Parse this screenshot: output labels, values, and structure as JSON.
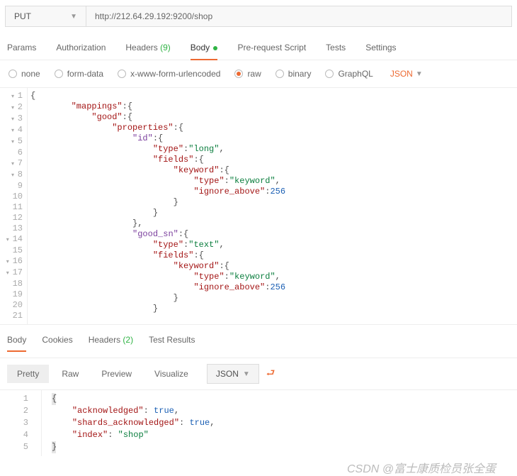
{
  "url_bar": {
    "method": "PUT",
    "url": "http://212.64.29.192:9200/shop"
  },
  "tabs": {
    "params": "Params",
    "auth": "Authorization",
    "headers_label": "Headers",
    "headers_count": "(9)",
    "body": "Body",
    "prerequest": "Pre-request Script",
    "tests": "Tests",
    "settings": "Settings"
  },
  "body_types": {
    "none": "none",
    "formdata": "form-data",
    "xwww": "x-www-form-urlencoded",
    "raw": "raw",
    "binary": "binary",
    "graphql": "GraphQL",
    "format": "JSON"
  },
  "req_lines": [
    {
      "n": 1,
      "f": 1,
      "i": 0,
      "t": "{",
      "c": ""
    },
    {
      "n": 2,
      "f": 1,
      "i": 2,
      "t": "\"mappings\":{",
      "c": "k"
    },
    {
      "n": 3,
      "f": 1,
      "i": 3,
      "t": "\"good\":{",
      "c": "k"
    },
    {
      "n": 4,
      "f": 1,
      "i": 4,
      "t": "\"properties\":{",
      "c": "k"
    },
    {
      "n": 5,
      "f": 1,
      "i": 5,
      "t": "\"id\":{",
      "c": "id"
    },
    {
      "n": 6,
      "f": 0,
      "i": 6,
      "t": "\"type\":\"long\",",
      "c": "kv"
    },
    {
      "n": 7,
      "f": 1,
      "i": 6,
      "t": "\"fields\":{",
      "c": "k"
    },
    {
      "n": 8,
      "f": 1,
      "i": 7,
      "t": "\"keyword\":{",
      "c": "k"
    },
    {
      "n": 9,
      "f": 0,
      "i": 8,
      "t": "\"type\":\"keyword\",",
      "c": "kv"
    },
    {
      "n": 10,
      "f": 0,
      "i": 8,
      "t": "\"ignore_above\":256",
      "c": "kn"
    },
    {
      "n": 11,
      "f": 0,
      "i": 7,
      "t": "}",
      "c": ""
    },
    {
      "n": 12,
      "f": 0,
      "i": 6,
      "t": "}",
      "c": ""
    },
    {
      "n": 13,
      "f": 0,
      "i": 5,
      "t": "},",
      "c": ""
    },
    {
      "n": 14,
      "f": 1,
      "i": 5,
      "t": "\"good_sn\":{",
      "c": "id"
    },
    {
      "n": 15,
      "f": 0,
      "i": 6,
      "t": "\"type\":\"text\",",
      "c": "kv"
    },
    {
      "n": 16,
      "f": 1,
      "i": 6,
      "t": "\"fields\":{",
      "c": "k"
    },
    {
      "n": 17,
      "f": 1,
      "i": 7,
      "t": "\"keyword\":{",
      "c": "k"
    },
    {
      "n": 18,
      "f": 0,
      "i": 8,
      "t": "\"type\":\"keyword\",",
      "c": "kv"
    },
    {
      "n": 19,
      "f": 0,
      "i": 8,
      "t": "\"ignore_above\":256",
      "c": "kn"
    },
    {
      "n": 20,
      "f": 0,
      "i": 7,
      "t": "}",
      "c": ""
    },
    {
      "n": 21,
      "f": 0,
      "i": 6,
      "t": "}",
      "c": ""
    }
  ],
  "resp_tabs": {
    "body": "Body",
    "cookies": "Cookies",
    "headers_label": "Headers",
    "headers_count": "(2)",
    "testresults": "Test Results"
  },
  "view_modes": {
    "pretty": "Pretty",
    "raw": "Raw",
    "preview": "Preview",
    "visualize": "Visualize",
    "format": "JSON"
  },
  "resp_lines": {
    "l1": "{",
    "l2_k": "\"acknowledged\"",
    "l2_v": "true",
    "l3_k": "\"shards_acknowledged\"",
    "l3_v": "true",
    "l4_k": "\"index\"",
    "l4_v": "\"shop\"",
    "l5": "}"
  },
  "watermark": "CSDN @富士康质检员张全蛋"
}
